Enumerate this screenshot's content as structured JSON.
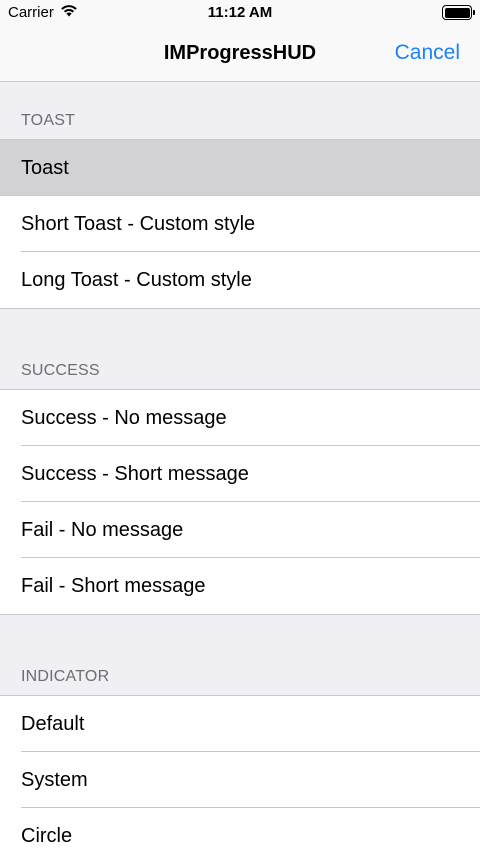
{
  "status_bar": {
    "carrier": "Carrier",
    "time": "11:12 AM",
    "wifi_icon": "wifi-icon",
    "battery_icon": "battery-icon"
  },
  "nav": {
    "title": "IMProgressHUD",
    "cancel_label": "Cancel"
  },
  "colors": {
    "accent": "#1a82fb",
    "selected_row": "#d1d1d6",
    "background": "#efeff4",
    "section_text": "#6d6d72"
  },
  "sections": {
    "toast": {
      "header": "TOAST",
      "items": [
        "Toast",
        "Short Toast - Custom style",
        "Long Toast - Custom style"
      ]
    },
    "success": {
      "header": "SUCCESS",
      "items": [
        "Success - No message",
        "Success - Short message",
        "Fail - No message",
        "Fail - Short message"
      ]
    },
    "indicator": {
      "header": "INDICATOR",
      "items": [
        "Default",
        "System",
        "Circle"
      ]
    }
  }
}
